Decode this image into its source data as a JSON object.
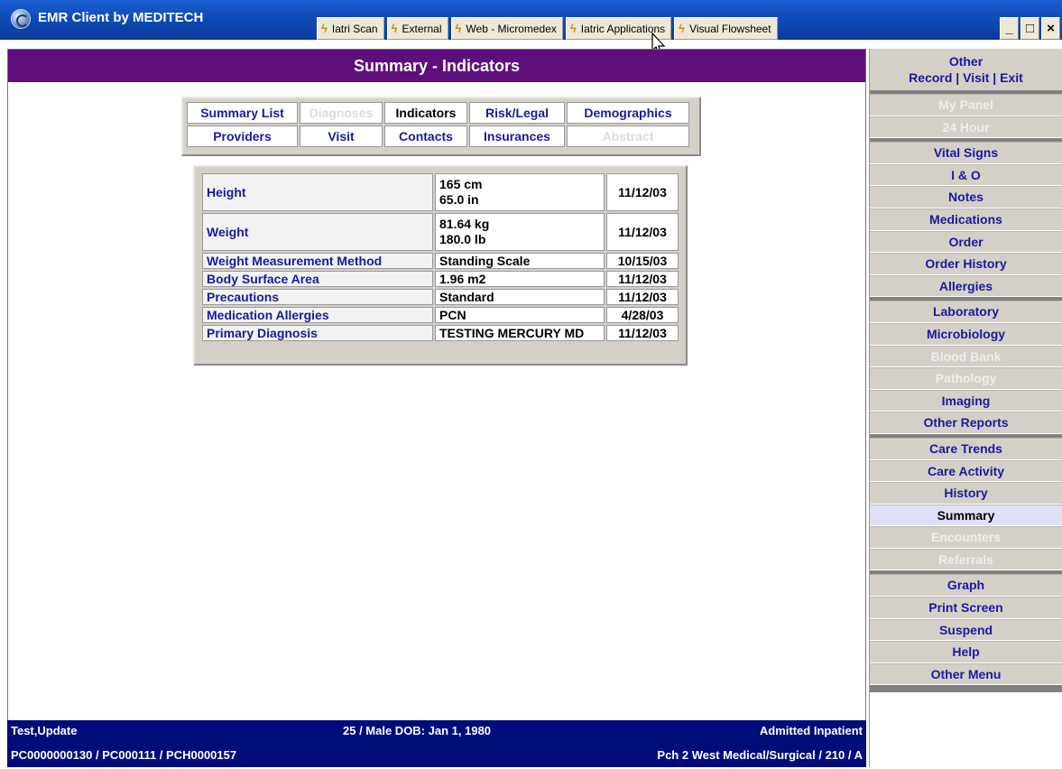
{
  "app": {
    "title": "EMR Client by MEDITECH"
  },
  "external_buttons": [
    {
      "label": "Iatri Scan"
    },
    {
      "label": "External"
    },
    {
      "label": "Web - Micromedex"
    },
    {
      "label": "Iatric Applications"
    },
    {
      "label": "Visual Flowsheet"
    }
  ],
  "window_controls": {
    "minimize": "_",
    "maximize": "□",
    "close": "×"
  },
  "header": {
    "title": "Summary - Indicators"
  },
  "tabs": [
    {
      "label": "Summary List",
      "state": "enabled"
    },
    {
      "label": "Diagnoses",
      "state": "disabled"
    },
    {
      "label": "Indicators",
      "state": "active"
    },
    {
      "label": "Risk/Legal",
      "state": "enabled"
    },
    {
      "label": "Demographics",
      "state": "enabled"
    },
    {
      "label": "Providers",
      "state": "enabled"
    },
    {
      "label": "Visit",
      "state": "enabled"
    },
    {
      "label": "Contacts",
      "state": "enabled"
    },
    {
      "label": "Insurances",
      "state": "enabled"
    },
    {
      "label": "Abstract",
      "state": "disabled"
    }
  ],
  "indicators": [
    {
      "label": "Height",
      "value1": "165 cm",
      "value2": "65.0 in",
      "date": "11/12/03"
    },
    {
      "label": "Weight",
      "value1": "81.64 kg",
      "value2": "180.0 lb",
      "date": "11/12/03"
    },
    {
      "label": "Weight Measurement Method",
      "value1": "Standing Scale",
      "date": "10/15/03"
    },
    {
      "label": "Body Surface Area",
      "value1": "1.96 m2",
      "date": "11/12/03"
    },
    {
      "label": "Precautions",
      "value1": "Standard",
      "date": "11/12/03"
    },
    {
      "label": "Medication Allergies",
      "value1": "PCN",
      "date": "4/28/03"
    },
    {
      "label": "Primary Diagnosis",
      "value1": "TESTING MERCURY MD",
      "date": "11/12/03"
    }
  ],
  "patient": {
    "name": "Test,Update",
    "demographics": "25 / Male  DOB: Jan 1, 1980",
    "status": "Admitted Inpatient",
    "ids": "PC0000000130 / PC000111 / PCH0000157",
    "location": "Pch 2 West Medical/Surgical / 210 / A"
  },
  "rightnav": {
    "other_label": "Other",
    "links": [
      "Record",
      "Visit",
      "Exit"
    ],
    "groups": [
      [
        {
          "label": "My Panel",
          "state": "disabled"
        },
        {
          "label": "24 Hour",
          "state": "disabled"
        }
      ],
      [
        {
          "label": "Vital Signs"
        },
        {
          "label": "I & O"
        },
        {
          "label": "Notes"
        },
        {
          "label": "Medications"
        },
        {
          "label": "Order"
        },
        {
          "label": "Order History"
        },
        {
          "label": "Allergies"
        }
      ],
      [
        {
          "label": "Laboratory"
        },
        {
          "label": "Microbiology"
        },
        {
          "label": "Blood Bank",
          "state": "disabled"
        },
        {
          "label": "Pathology",
          "state": "disabled"
        },
        {
          "label": "Imaging"
        },
        {
          "label": "Other Reports"
        }
      ],
      [
        {
          "label": "Care Trends"
        },
        {
          "label": "Care Activity"
        },
        {
          "label": "History"
        },
        {
          "label": "Summary",
          "state": "selected"
        },
        {
          "label": "Encounters",
          "state": "disabled"
        },
        {
          "label": "Referrals",
          "state": "disabled"
        }
      ],
      [
        {
          "label": "Graph"
        },
        {
          "label": "Print Screen"
        },
        {
          "label": "Suspend"
        },
        {
          "label": "Help"
        },
        {
          "label": "Other Menu"
        }
      ]
    ]
  }
}
